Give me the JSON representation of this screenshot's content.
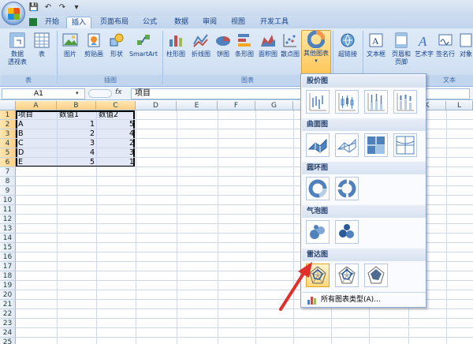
{
  "qat": {
    "undo_icon": "undo-icon",
    "redo_icon": "redo-icon",
    "save_icon": "save-icon"
  },
  "tabs": [
    {
      "label": "开始"
    },
    {
      "label": "插入"
    },
    {
      "label": "页面布局"
    },
    {
      "label": "公式"
    },
    {
      "label": "数据"
    },
    {
      "label": "审阅"
    },
    {
      "label": "视图"
    },
    {
      "label": "开发工具"
    }
  ],
  "ribbon": {
    "groups": {
      "table": "表",
      "illustration": "插图",
      "charts": "图表",
      "text": "文本"
    },
    "buttons": {
      "pivot_line1": "数据",
      "pivot_line2": "透视表",
      "table": "表",
      "picture": "图片",
      "clipart": "剪贴画",
      "shape": "形状",
      "smartart": "SmartArt",
      "column": "柱形图",
      "line": "折线图",
      "pie": "饼图",
      "bar": "条形图",
      "area": "面积图",
      "scatter": "散点图",
      "other": "其他图表",
      "hyperlink": "超链接",
      "textbox": "文本框",
      "header_line1": "页眉和",
      "header_line2": "页脚",
      "wordart": "艺术字",
      "signature": "签名行",
      "object": "对象"
    }
  },
  "formula_bar": {
    "cell_ref": "A1",
    "fx": "fx",
    "content": "项目"
  },
  "grid": {
    "columns": [
      "A",
      "B",
      "C",
      "D",
      "E",
      "F",
      "G",
      "H",
      "I",
      "J",
      "K",
      "L"
    ],
    "rows": [
      "1",
      "2",
      "3",
      "4",
      "5",
      "6",
      "7",
      "8",
      "9",
      "10",
      "11",
      "12",
      "13",
      "14",
      "15",
      "16",
      "17",
      "18",
      "19",
      "20",
      "21",
      "22",
      "23",
      "24",
      "25"
    ],
    "headers": [
      "项目",
      "数值1",
      "数值2"
    ],
    "data": [
      [
        "A",
        "1",
        "5"
      ],
      [
        "B",
        "2",
        "4"
      ],
      [
        "C",
        "3",
        "2"
      ],
      [
        "D",
        "4",
        "3"
      ],
      [
        "E",
        "5",
        "1"
      ]
    ]
  },
  "gallery": {
    "sections": {
      "stock": "股价图",
      "surface": "曲面图",
      "doughnut": "圆环图",
      "bubble": "气泡图",
      "radar": "雷达图"
    },
    "footer": "所有图表类型(A)..."
  },
  "colors": {
    "accent": "#15428b",
    "ribbon": "#d4e3f4",
    "highlight": "#ffc75a",
    "arrow": "#e0302a"
  }
}
